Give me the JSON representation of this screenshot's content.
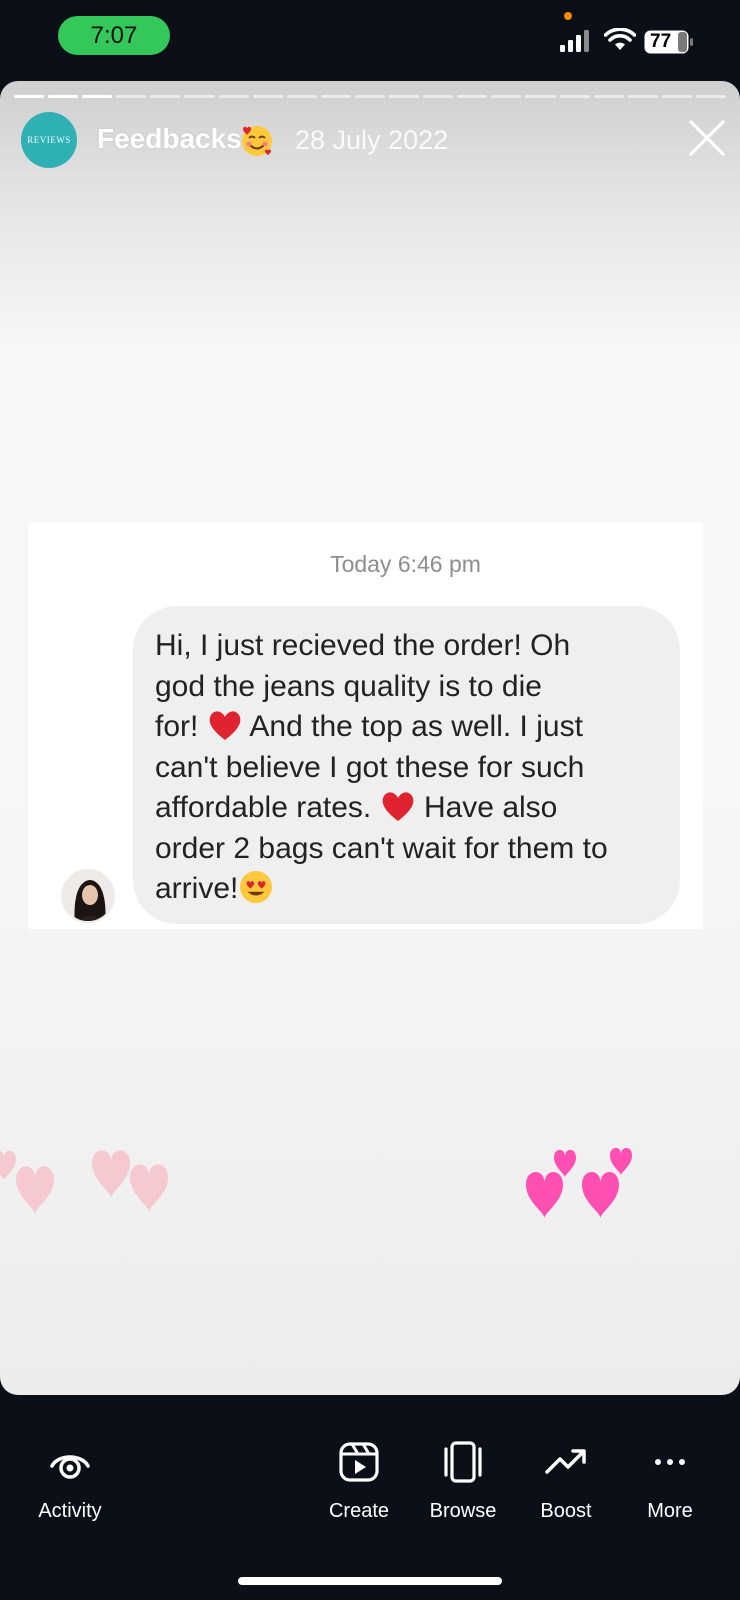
{
  "status_bar": {
    "time": "7:07",
    "battery": "77"
  },
  "story": {
    "progress_segments_total": 21,
    "progress_segments_viewed": 3,
    "account_avatar_text": "REVIEWS",
    "account_name": "Feedbacks",
    "name_emoji_icon": "smiling-face-with-hearts-icon",
    "date": "28 July 2022"
  },
  "chat": {
    "timestamp": "Today 6:46 pm",
    "message_lines": [
      "Hi, I just recieved the order! Oh",
      "god the jeans quality is to die",
      "for!",
      "And the top as well. I just",
      "can't believe I got these for such",
      "affordable rates.",
      "Have also",
      "order 2 bags can't wait for them to",
      "arrive!"
    ]
  },
  "nav": {
    "activity": "Activity",
    "create": "Create",
    "browse": "Browse",
    "boost": "Boost",
    "more": "More"
  },
  "colors": {
    "background": "#0b0f17",
    "time_pill": "#34c759",
    "avatar_teal": "#2fb0b5",
    "bubble": "#efefef",
    "heart_red": "#e0242f",
    "heart_pink": "#ff4fb3"
  }
}
